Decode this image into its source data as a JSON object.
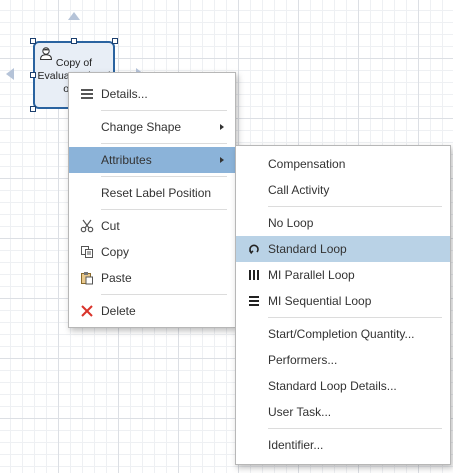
{
  "task": {
    "lines": [
      "Copy of",
      "Evaluate Situati",
      "on P",
      "("
    ]
  },
  "context_menu": {
    "details": "Details...",
    "change_shape": "Change Shape",
    "attributes": "Attributes",
    "reset_label_position": "Reset Label Position",
    "cut": "Cut",
    "copy": "Copy",
    "paste": "Paste",
    "delete": "Delete"
  },
  "submenu": {
    "compensation": "Compensation",
    "call_activity": "Call Activity",
    "no_loop": "No Loop",
    "standard_loop": "Standard Loop",
    "mi_parallel_loop": "MI Parallel Loop",
    "mi_sequential_loop": "MI Sequential Loop",
    "start_completion_quantity": "Start/Completion Quantity...",
    "performers": "Performers...",
    "standard_loop_details": "Standard Loop Details...",
    "user_task": "User Task...",
    "identifier": "Identifier..."
  },
  "colors": {
    "task_border": "#2a63a0",
    "highlight": "#8bb3d9",
    "selected": "#b9d2e6",
    "delete_icon": "#d9342b"
  }
}
